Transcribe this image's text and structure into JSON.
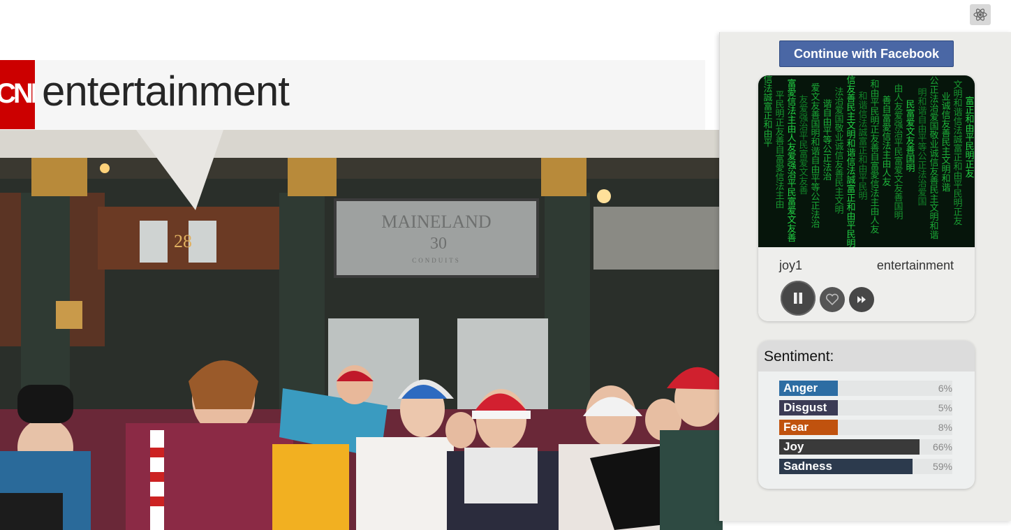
{
  "site": {
    "logo_text": "CNN",
    "section": "entertainment"
  },
  "hero": {
    "sign_text": "MAINELAND",
    "sign_number": "30",
    "sign_sub": "CONDUITS",
    "window_number": "28"
  },
  "extension": {
    "toggle_icon": "atom-icon"
  },
  "panel": {
    "facebook_button": "Continue with Facebook",
    "player": {
      "user": "joy1",
      "station": "entertainment",
      "matrix_glyphs": "信法誠富正和由平民明正友善自富愛信法主由人友爱强治平民富爱文友善国明和谐自由平等公正法治爱国敬业诚信友善民主文明和谐",
      "controls": [
        "pause-icon",
        "heart-icon",
        "next-icon"
      ]
    },
    "sentiment": {
      "title": "Sentiment:",
      "items": [
        {
          "label": "Anger",
          "pct": "6%",
          "value": 0.34,
          "color": "#2d6da3"
        },
        {
          "label": "Disgust",
          "pct": "5%",
          "value": 0.34,
          "color": "#3b3b55"
        },
        {
          "label": "Fear",
          "pct": "8%",
          "value": 0.34,
          "color": "#c0520e"
        },
        {
          "label": "Joy",
          "pct": "66%",
          "value": 0.81,
          "color": "#3a3a3a"
        },
        {
          "label": "Sadness",
          "pct": "59%",
          "value": 0.77,
          "color": "#2c3a4d"
        }
      ]
    }
  }
}
